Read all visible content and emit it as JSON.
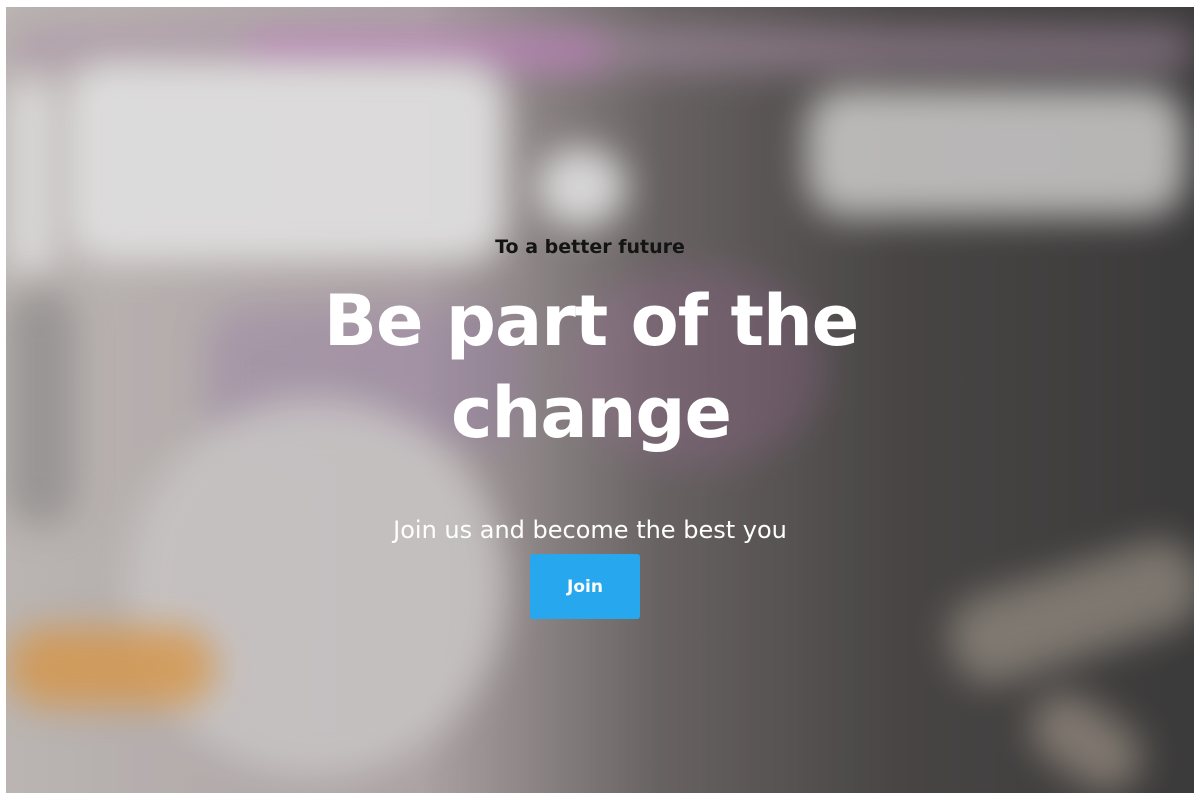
{
  "hero": {
    "eyebrow": "To a better future",
    "headline": "Be part of the change",
    "subtitle": "Join us and become the best you",
    "join_label": "Join"
  },
  "colors": {
    "button_bg": "#26a7ee",
    "headline_text": "#ffffff",
    "eyebrow_text": "#141414"
  }
}
